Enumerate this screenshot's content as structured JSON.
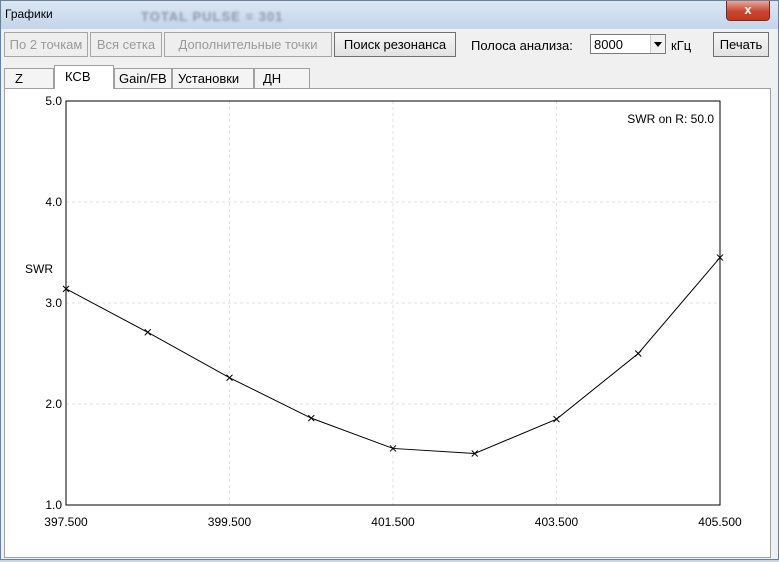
{
  "window": {
    "title": "Графики",
    "background_text": "TOTAL PULSE = 301",
    "close_label": "x"
  },
  "toolbar": {
    "by_two_points": "По 2 точкам",
    "whole_grid": "Вся сетка",
    "extra_points": "Дополнительные точки",
    "find_resonance": "Поиск резонанса",
    "band_label": "Полоса анализа:",
    "band_value": "8000",
    "band_unit": "кГц",
    "print": "Печать"
  },
  "tabs": [
    {
      "label": "Z"
    },
    {
      "label": "КСВ",
      "selected": true
    },
    {
      "label": "Gain/FB"
    },
    {
      "label": "Установки"
    },
    {
      "label": "ДН"
    }
  ],
  "chart_data": {
    "type": "line",
    "ylabel": "SWR",
    "annotation": "SWR on R: 50.0",
    "xlim": [
      397.5,
      405.5
    ],
    "ylim": [
      1.0,
      5.0
    ],
    "x_ticks": [
      "397.500",
      "399.500",
      "401.500",
      "403.500",
      "405.500"
    ],
    "y_ticks": [
      "1.0",
      "2.0",
      "3.0",
      "4.0",
      "5.0"
    ],
    "grid": true,
    "color": "#000000",
    "series": [
      {
        "x": [
          397.5,
          398.5,
          399.5,
          400.5,
          401.5,
          402.5,
          403.5,
          404.5,
          405.5
        ],
        "values": [
          3.14,
          2.71,
          2.26,
          1.86,
          1.56,
          1.51,
          1.85,
          2.5,
          3.45
        ]
      }
    ]
  }
}
